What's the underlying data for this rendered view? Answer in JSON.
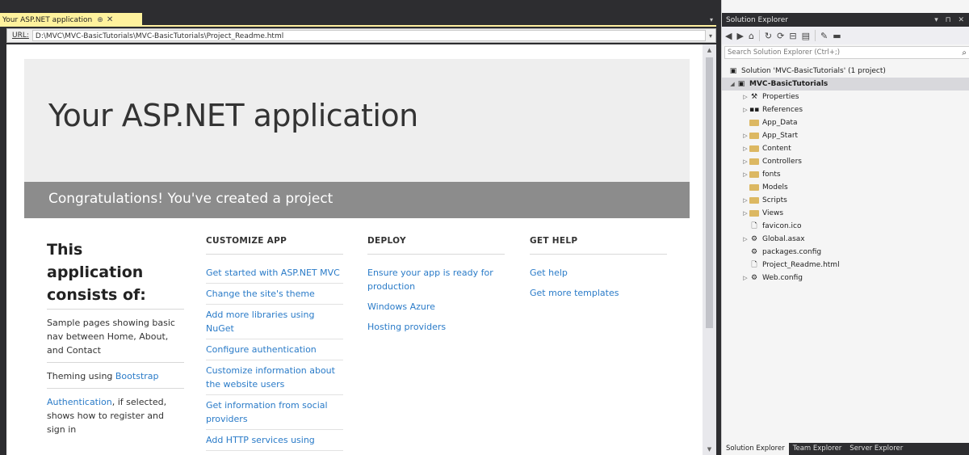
{
  "editor": {
    "tab_title": "Your ASP.NET application",
    "tab_pin": "⊕",
    "tab_close": "✕",
    "url_label": "URL:",
    "url_value": "D:\\MVC\\MVC-BasicTutorials\\MVC-BasicTutorials\\Project_Readme.html"
  },
  "page": {
    "heading": "Your ASP.NET application",
    "congrats": "Congratulations! You've created a project",
    "intro_title": "This application consists of:",
    "intro_items": [
      {
        "pre": "",
        "link": "",
        "post": "Sample pages showing basic nav between Home, About, and Contact"
      },
      {
        "pre": "Theming using ",
        "link": "Bootstrap",
        "post": ""
      },
      {
        "pre": "",
        "link": "Authentication",
        "post": ", if selected, shows how to register and sign in"
      }
    ],
    "columns": [
      {
        "title": "CUSTOMIZE APP",
        "items": [
          "Get started with ASP.NET MVC",
          "Change the site's theme",
          "Add more libraries using NuGet",
          "Configure authentication",
          "Customize information about the website users",
          "Get information from social providers",
          "Add HTTP services using"
        ]
      },
      {
        "title": "DEPLOY",
        "items": [
          "Ensure your app is ready for production",
          "Windows Azure",
          "Hosting providers"
        ]
      },
      {
        "title": "GET HELP",
        "items": [
          "Get help",
          "Get more templates"
        ]
      }
    ]
  },
  "solution_explorer": {
    "title": "Solution Explorer",
    "title_actions": "▾ ⊓ ✕",
    "search_placeholder": "Search Solution Explorer (Ctrl+;)",
    "solution_label": "Solution 'MVC-BasicTutorials' (1 project)",
    "project_label": "MVC-BasicTutorials",
    "items": [
      {
        "label": "Properties",
        "icon": "wrench-icon",
        "expandable": true
      },
      {
        "label": "References",
        "icon": "references-icon",
        "expandable": true
      },
      {
        "label": "App_Data",
        "icon": "folder-icon",
        "expandable": false
      },
      {
        "label": "App_Start",
        "icon": "folder-icon",
        "expandable": true
      },
      {
        "label": "Content",
        "icon": "folder-icon",
        "expandable": true
      },
      {
        "label": "Controllers",
        "icon": "folder-icon",
        "expandable": true
      },
      {
        "label": "fonts",
        "icon": "folder-icon",
        "expandable": true
      },
      {
        "label": "Models",
        "icon": "folder-icon",
        "expandable": false
      },
      {
        "label": "Scripts",
        "icon": "folder-icon",
        "expandable": true
      },
      {
        "label": "Views",
        "icon": "folder-icon",
        "expandable": true
      },
      {
        "label": "favicon.ico",
        "icon": "file-icon",
        "expandable": false
      },
      {
        "label": "Global.asax",
        "icon": "config-file-icon",
        "expandable": true
      },
      {
        "label": "packages.config",
        "icon": "config-file-icon",
        "expandable": false
      },
      {
        "label": "Project_Readme.html",
        "icon": "file-icon",
        "expandable": false
      },
      {
        "label": "Web.config",
        "icon": "config-file-icon",
        "expandable": true
      }
    ],
    "bottom_tabs": [
      "Solution Explorer",
      "Team Explorer",
      "Server Explorer"
    ]
  },
  "colors": {
    "accent_tab": "#fff29d",
    "link": "#2a7bc8",
    "chrome": "#2d2d30",
    "folder": "#dcb862"
  }
}
